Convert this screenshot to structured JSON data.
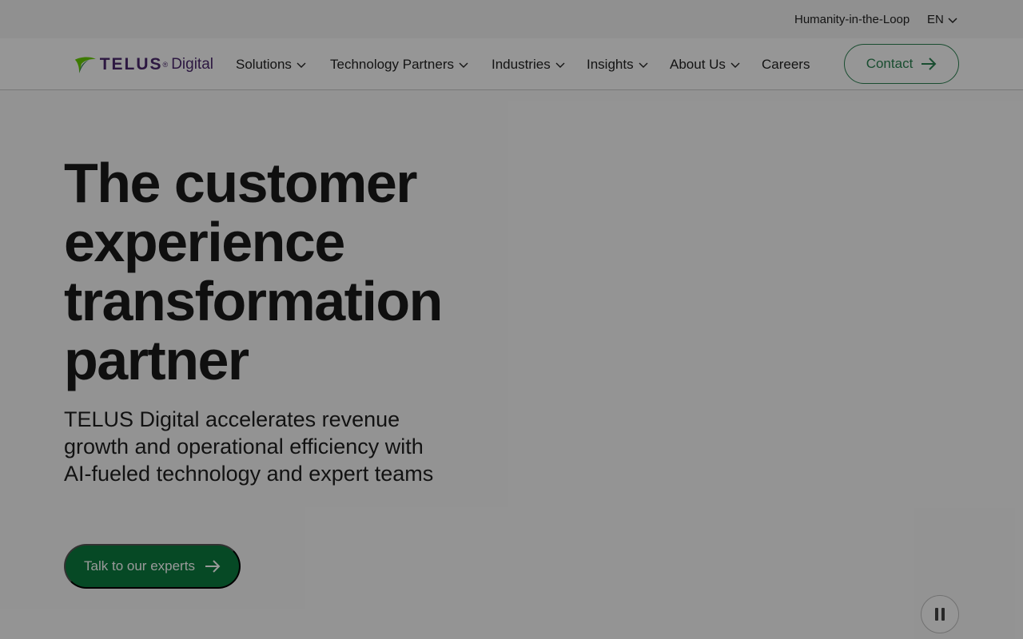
{
  "topbar": {
    "hitl_label": "Humanity-in-the-Loop",
    "language": "EN"
  },
  "logo": {
    "brand": "TELUS",
    "suffix": "Digital",
    "reg": "®"
  },
  "nav": {
    "items": [
      {
        "label": "Solutions",
        "has_dropdown": true
      },
      {
        "label": "Technology Partners",
        "has_dropdown": true
      },
      {
        "label": "Industries",
        "has_dropdown": true
      },
      {
        "label": "Insights",
        "has_dropdown": true
      },
      {
        "label": "About Us",
        "has_dropdown": true
      },
      {
        "label": "Careers",
        "has_dropdown": false
      }
    ],
    "contact_label": "Contact"
  },
  "hero": {
    "line1": "The customer",
    "line2": "experience",
    "line3": "transformation",
    "line4": "partner",
    "subcopy": "TELUS Digital accelerates revenue growth and operational efficiency with AI-fueled technology and expert teams",
    "cta_label": "Talk to our experts"
  },
  "colors": {
    "accent_green": "#0a7a3e",
    "brand_purple": "#4b286d",
    "logo_green": "#66cc00"
  },
  "icons": {
    "chevron": "chevron-down-icon",
    "arrow": "arrow-right-icon",
    "pause": "pause-icon"
  }
}
